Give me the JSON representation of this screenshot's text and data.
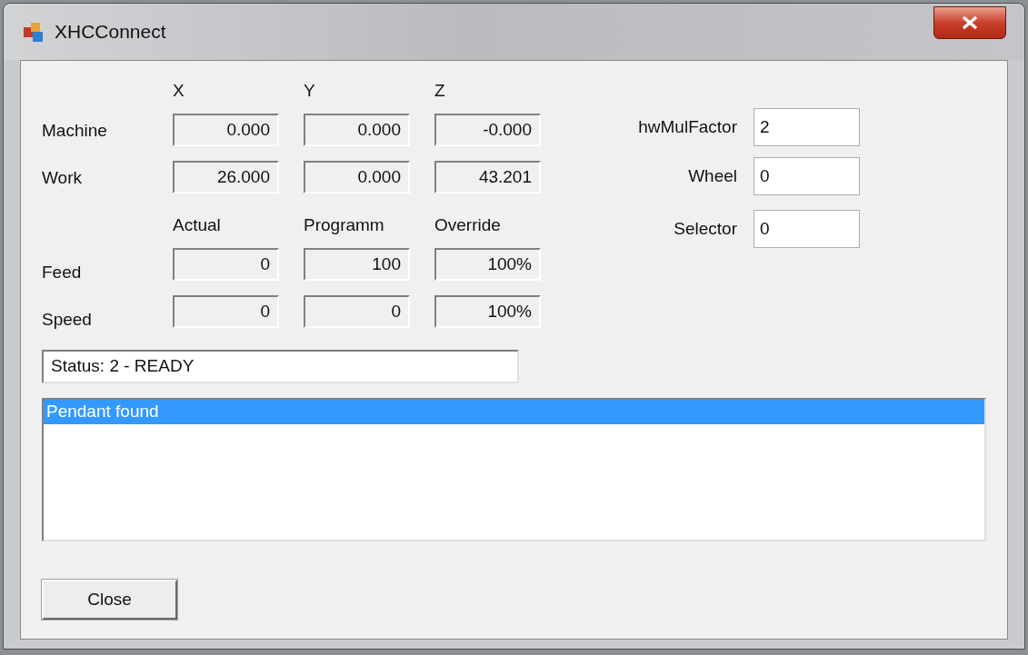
{
  "window": {
    "title": "XHCConnect"
  },
  "position": {
    "columns": [
      "X",
      "Y",
      "Z"
    ],
    "rows": [
      {
        "label": "Machine",
        "values": [
          "0.000",
          "0.000",
          "-0.000"
        ]
      },
      {
        "label": "Work",
        "values": [
          "26.000",
          "0.000",
          "43.201"
        ]
      }
    ]
  },
  "rates": {
    "columns": [
      "Actual",
      "Programm",
      "Override"
    ],
    "rows": [
      {
        "label": "Feed",
        "values": [
          "0",
          "100",
          "100%"
        ]
      },
      {
        "label": "Speed",
        "values": [
          "0",
          "0",
          "100%"
        ]
      }
    ]
  },
  "pendant": [
    {
      "label": "hwMulFactor",
      "value": "2"
    },
    {
      "label": "Wheel",
      "value": "0"
    },
    {
      "label": "Selector",
      "value": "0"
    }
  ],
  "status": "Status: 2 - READY",
  "log": [
    {
      "text": "Pendant found",
      "selected": true
    }
  ],
  "buttons": [
    "Close"
  ]
}
